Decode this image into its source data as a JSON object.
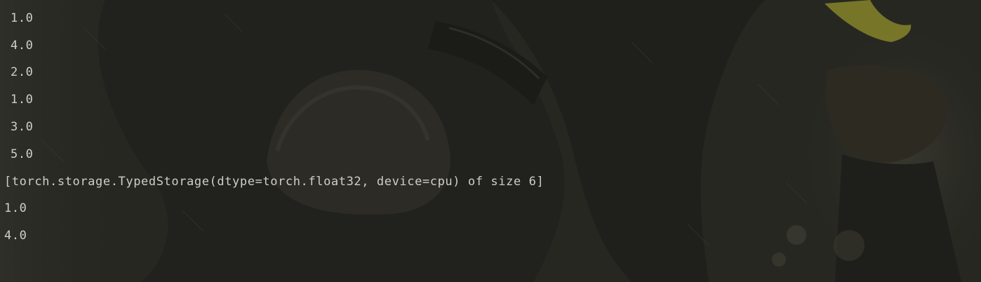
{
  "console": {
    "lines": [
      "1.0",
      "4.0",
      "2.0",
      "1.0",
      "3.0",
      "5.0",
      "[torch.storage.TypedStorage(dtype=torch.float32, device=cpu) of size 6]",
      "1.0",
      "4.0"
    ]
  },
  "colors": {
    "background": "#272722",
    "text": "#cfcfc6",
    "accent_leaf": "#a3a02c"
  }
}
